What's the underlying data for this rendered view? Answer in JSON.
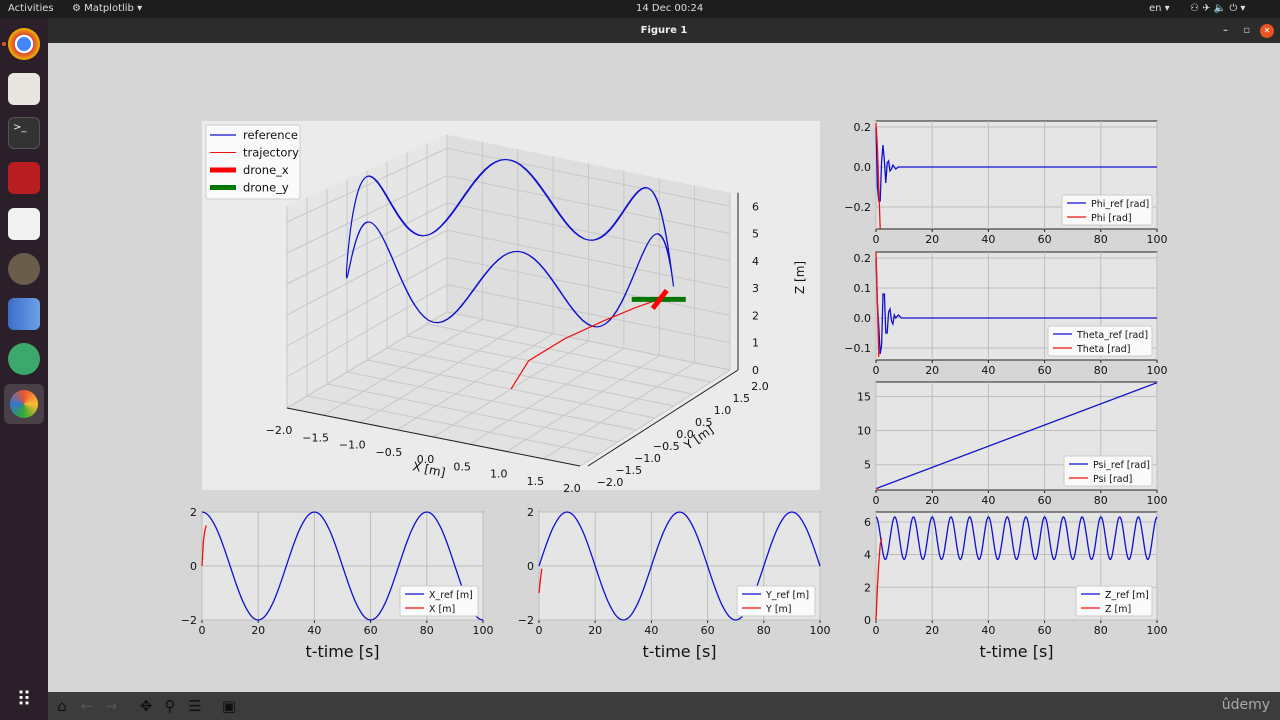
{
  "system": {
    "activities": "Activities",
    "app_menu": "Matplotlib ▾",
    "clock": "14 Dec  00:24",
    "lang": "en ▾",
    "status_icons": "⚇ ✈ 🔈 ⏻ ▾"
  },
  "window": {
    "title": "Figure 1",
    "minimize": "–",
    "restore": "▫",
    "close": "✕"
  },
  "dock": [
    {
      "name": "chrome"
    },
    {
      "name": "files"
    },
    {
      "name": "terminal"
    },
    {
      "name": "app-red"
    },
    {
      "name": "document-viewer"
    },
    {
      "name": "gimp"
    },
    {
      "name": "code"
    },
    {
      "name": "atom"
    },
    {
      "name": "matplotlib"
    },
    {
      "name": "show-apps"
    }
  ],
  "toolbar": {
    "home": "home-icon",
    "back": "back-icon",
    "forward": "forward-icon",
    "pan": "pan-icon",
    "zoom": "zoom-icon",
    "configure": "configure-icon",
    "save": "save-icon"
  },
  "watermark": "ûdemy",
  "colors": {
    "ref": "#1010d0",
    "actual": "#ee1111",
    "drone_x": "#ff0000",
    "drone_y": "#007700",
    "axes_bg": "#e5e5e5",
    "grid": "#bdbdbd"
  },
  "chart_data": [
    {
      "type": "line3d",
      "legend": [
        "reference",
        "trajectory",
        "drone_x",
        "drone_y"
      ],
      "legend_position": "top-left",
      "xlabel": "X [m]",
      "ylabel": "Y [m]",
      "zlabel": "Z [m]",
      "xlim": [
        -2,
        2
      ],
      "ylim": [
        -2,
        2
      ],
      "zlim": [
        0,
        6.5
      ],
      "xticks": [
        "−2.0",
        "−1.5",
        "−1.0",
        "−0.5",
        "0.0",
        "0.5",
        "1.0",
        "1.5",
        "2.0"
      ],
      "yticks": [
        "−2.0",
        "−1.5",
        "−1.0",
        "−0.5",
        "0.0",
        "0.5",
        "1.0",
        "1.5",
        "2.0"
      ],
      "zticks": [
        "0",
        "1",
        "2",
        "3",
        "4",
        "5",
        "6"
      ],
      "reference": {
        "x_amplitude": 2,
        "y_amplitude": 2,
        "xy_period": 40,
        "z_mean": 5,
        "z_amplitude": 1.3,
        "z_period": 6.67,
        "t_range": [
          0,
          100
        ]
      },
      "trajectory": [
        [
          0,
          0,
          0
        ],
        [
          0.3,
          -0.1,
          1.2
        ],
        [
          0.8,
          -0.1,
          2.2
        ],
        [
          1.3,
          0,
          3.0
        ],
        [
          1.7,
          0.05,
          3.6
        ],
        [
          2.0,
          0.1,
          4.0
        ]
      ],
      "drone_position": [
        2.0,
        0.1,
        4.0
      ]
    },
    {
      "type": "line",
      "name": "X",
      "xlabel": "t-time [s]",
      "xlim": [
        0,
        100
      ],
      "ylim": [
        -2,
        2
      ],
      "xticks": [
        "0",
        "20",
        "40",
        "60",
        "80",
        "100"
      ],
      "yticks": [
        "−2",
        "0",
        "2"
      ],
      "ytick_values": [
        -2,
        0,
        2
      ],
      "legend": [
        "X_ref [m]",
        "X [m]"
      ],
      "legend_position": "lower-right",
      "t": [
        0,
        5,
        10,
        15,
        20,
        25,
        30,
        35,
        40,
        45,
        50,
        55,
        60,
        65,
        70,
        75,
        80,
        85,
        90,
        95,
        100
      ],
      "ref": [
        2,
        1.41,
        0,
        -1.41,
        -2,
        -1.41,
        0,
        1.41,
        2,
        1.41,
        0,
        -1.41,
        -2,
        -1.41,
        0,
        1.41,
        2,
        1.41,
        0,
        -1.41,
        -2
      ],
      "actual": [
        [
          0,
          0
        ],
        [
          0.5,
          0.9
        ],
        [
          1,
          1.3
        ],
        [
          1.5,
          1.5
        ]
      ]
    },
    {
      "type": "line",
      "name": "Y",
      "xlabel": "t-time [s]",
      "xlim": [
        0,
        100
      ],
      "ylim": [
        -2,
        2
      ],
      "xticks": [
        "0",
        "20",
        "40",
        "60",
        "80",
        "100"
      ],
      "yticks": [
        "−2",
        "0",
        "2"
      ],
      "ytick_values": [
        -2,
        0,
        2
      ],
      "legend": [
        "Y_ref [m]",
        "Y [m]"
      ],
      "legend_position": "lower-right",
      "t": [
        0,
        5,
        10,
        15,
        20,
        25,
        30,
        35,
        40,
        45,
        50,
        55,
        60,
        65,
        70,
        75,
        80,
        85,
        90,
        95,
        100
      ],
      "ref": [
        0,
        1.41,
        2,
        1.41,
        0,
        -1.41,
        -2,
        -1.41,
        0,
        1.41,
        2,
        1.41,
        0,
        -1.41,
        -2,
        -1.41,
        0,
        1.41,
        2,
        1.41,
        0
      ],
      "actual": [
        [
          0,
          -1
        ],
        [
          0.5,
          -0.5
        ],
        [
          1,
          -0.1
        ]
      ]
    },
    {
      "type": "line",
      "name": "Phi",
      "xlim": [
        0,
        100
      ],
      "ylim": [
        -0.31,
        0.23
      ],
      "xticks": [
        "0",
        "20",
        "40",
        "60",
        "80",
        "100"
      ],
      "yticks": [
        "−0.2",
        "0.0",
        "0.2"
      ],
      "ytick_values": [
        -0.2,
        0,
        0.2
      ],
      "legend": [
        "Phi_ref [rad]",
        "Phi [rad]"
      ],
      "legend_position": "lower-right",
      "ref_points": [
        [
          0,
          0.2
        ],
        [
          0.5,
          -0.1
        ],
        [
          1,
          -0.17
        ],
        [
          1.5,
          -0.17
        ],
        [
          2,
          0.03
        ],
        [
          2.5,
          0.11
        ],
        [
          3,
          0.03
        ],
        [
          3.5,
          -0.08
        ],
        [
          4,
          0.02
        ],
        [
          4.5,
          0.03
        ],
        [
          5,
          -0.02
        ],
        [
          5.5,
          -0.01
        ],
        [
          6,
          0.01
        ],
        [
          7,
          -0.01
        ],
        [
          8,
          0
        ],
        [
          10,
          0
        ],
        [
          100,
          0
        ]
      ],
      "actual": [
        [
          0,
          0.22
        ],
        [
          0.5,
          0.1
        ],
        [
          1.5,
          -0.31
        ]
      ]
    },
    {
      "type": "line",
      "name": "Theta",
      "xlim": [
        0,
        100
      ],
      "ylim": [
        -0.14,
        0.22
      ],
      "xticks": [
        "0",
        "20",
        "40",
        "60",
        "80",
        "100"
      ],
      "yticks": [
        "−0.1",
        "0.0",
        "0.1",
        "0.2"
      ],
      "ytick_values": [
        -0.1,
        0,
        0.1,
        0.2
      ],
      "legend": [
        "Theta_ref [rad]",
        "Theta [rad]"
      ],
      "legend_position": "lower-right",
      "ref_points": [
        [
          0,
          0.2
        ],
        [
          0.5,
          0.05
        ],
        [
          1,
          -0.03
        ],
        [
          1.5,
          -0.12
        ],
        [
          2,
          -0.09
        ],
        [
          2.5,
          0.08
        ],
        [
          3,
          0.08
        ],
        [
          3.5,
          -0.05
        ],
        [
          4,
          -0.05
        ],
        [
          4.5,
          0.02
        ],
        [
          5,
          0.03
        ],
        [
          5.5,
          -0.01
        ],
        [
          6,
          -0.02
        ],
        [
          6.5,
          0.01
        ],
        [
          7,
          0
        ],
        [
          8,
          0.01
        ],
        [
          9,
          0
        ],
        [
          12,
          0
        ],
        [
          100,
          0
        ]
      ],
      "actual": [
        [
          0,
          0.22
        ],
        [
          0.5,
          0.05
        ],
        [
          1,
          -0.13
        ]
      ]
    },
    {
      "type": "line",
      "name": "Psi",
      "xlim": [
        0,
        100
      ],
      "ylim": [
        1.3,
        17.1
      ],
      "xticks": [
        "0",
        "20",
        "40",
        "60",
        "80",
        "100"
      ],
      "yticks": [
        "5",
        "10",
        "15"
      ],
      "ytick_values": [
        5,
        10,
        15
      ],
      "legend": [
        "Psi_ref [rad]",
        "Psi [rad]"
      ],
      "legend_position": "lower-right",
      "ref_points": [
        [
          0,
          1.5
        ],
        [
          100,
          17
        ]
      ],
      "actual": [
        [
          0,
          1.5
        ],
        [
          1,
          1.6
        ]
      ]
    },
    {
      "type": "line",
      "name": "Z",
      "xlabel": "t-time [s]",
      "xlim": [
        0,
        100
      ],
      "ylim": [
        0,
        6.6
      ],
      "xticks": [
        "0",
        "20",
        "40",
        "60",
        "80",
        "100"
      ],
      "yticks": [
        "0",
        "2",
        "4",
        "6"
      ],
      "ytick_values": [
        0,
        2,
        4,
        6
      ],
      "legend": [
        "Z_ref [m]",
        "Z [m]"
      ],
      "legend_position": "lower-right",
      "ref_model": {
        "mean": 5,
        "amplitude": 1.3,
        "period": 6.67
      },
      "actual": [
        [
          0,
          0
        ],
        [
          0.5,
          2
        ],
        [
          1,
          3.5
        ],
        [
          1.5,
          4.6
        ],
        [
          2,
          5
        ]
      ]
    }
  ]
}
